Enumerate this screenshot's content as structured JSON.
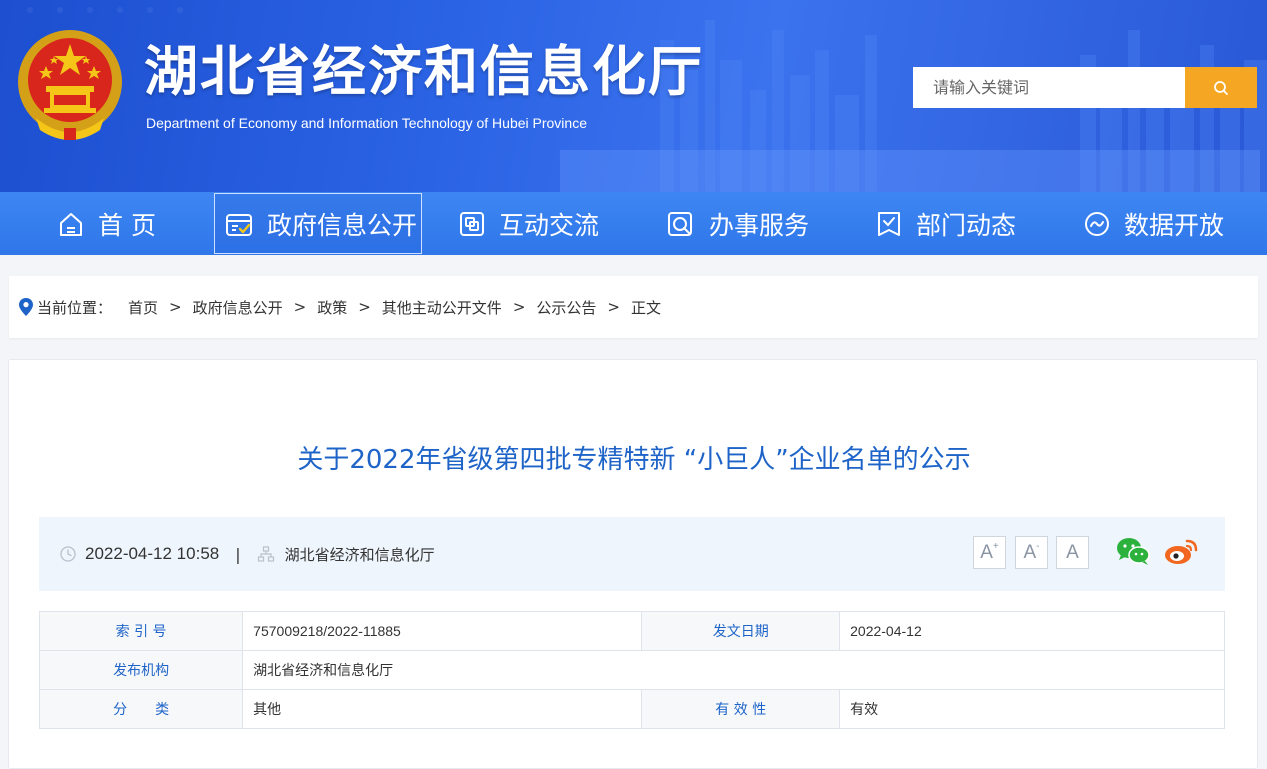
{
  "header": {
    "title": "湖北省经济和信息化厅",
    "subtitle": "Department of Economy and Information Technology of Hubei Province",
    "search_placeholder": "请输入关键词"
  },
  "nav": {
    "items": [
      {
        "label": "首 页",
        "icon": "home-icon"
      },
      {
        "label": "政府信息公开",
        "icon": "info-disclosure-icon",
        "active": true
      },
      {
        "label": "互动交流",
        "icon": "interaction-icon"
      },
      {
        "label": "办事服务",
        "icon": "service-search-icon"
      },
      {
        "label": "部门动态",
        "icon": "department-news-icon"
      },
      {
        "label": "数据开放",
        "icon": "data-open-icon"
      }
    ]
  },
  "breadcrumb": {
    "label": "当前位置：",
    "items": [
      "首页",
      "政府信息公开",
      "政策",
      "其他主动公开文件",
      "公示公告",
      "正文"
    ],
    "separator": ">"
  },
  "article": {
    "title": "关于2022年省级第四批专精特新 “小巨人”企业名单的公示",
    "datetime": "2022-04-12 10:58",
    "publisher": "湖北省经济和信息化厅",
    "font_buttons": [
      "A",
      "A",
      "A"
    ],
    "share": [
      "wechat-icon",
      "weibo-icon"
    ]
  },
  "info_table": {
    "rows": [
      {
        "label1": "索 引 号",
        "value1": "757009218/2022-11885",
        "label2": "发文日期",
        "value2": "2022-04-12"
      },
      {
        "label1": "发布机构",
        "value1": "湖北省经济和信息化厅"
      },
      {
        "label1": "分　　类",
        "value1": "其他",
        "label2": "有 效 性",
        "value2": "有效"
      }
    ]
  },
  "colors": {
    "nav_bg": "#2f77ea",
    "title_blue": "#1e64c8",
    "search_orange": "#f5a623"
  }
}
